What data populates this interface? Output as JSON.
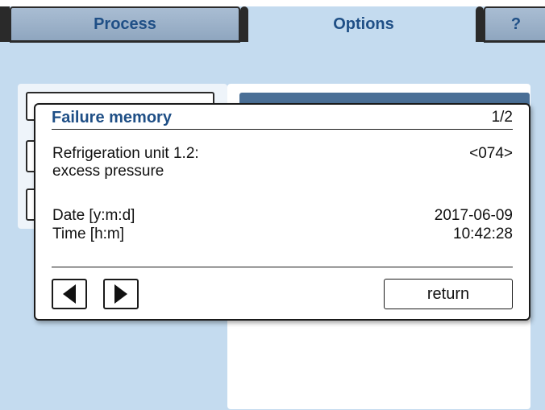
{
  "tabs": {
    "process": "Process",
    "options": "Options",
    "help": "?"
  },
  "dialog": {
    "title": "Failure memory",
    "page_indicator": "1/2",
    "fault_line1": "Refrigeration unit 1.2:",
    "fault_line2": "excess pressure",
    "fault_code": "<074>",
    "date_label": "Date [y:m:d]",
    "date_value": "2017-06-09",
    "time_label": "Time [h:m]",
    "time_value": "10:42:28",
    "prev_icon": "triangle-left-icon",
    "next_icon": "triangle-right-icon",
    "return_label": "return"
  },
  "colors": {
    "background": "#c4dbef",
    "title_blue": "#1f4f86",
    "header_blue": "#4a6f96"
  }
}
